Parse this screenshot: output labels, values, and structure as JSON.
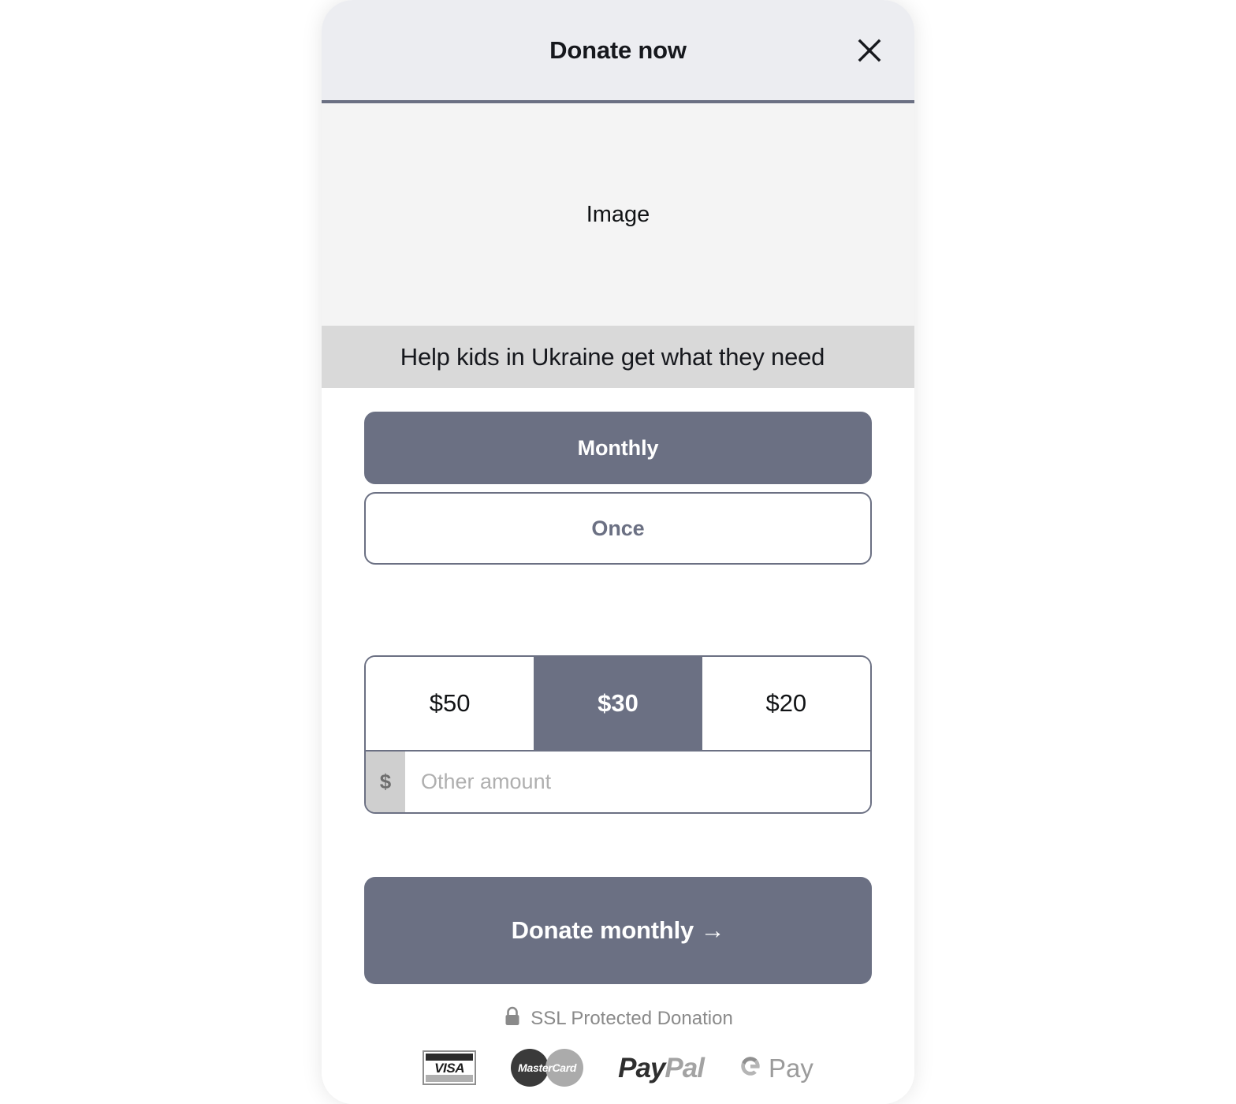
{
  "modal": {
    "header": {
      "title": "Donate now",
      "close_icon": "close-icon"
    },
    "image_placeholder": {
      "label": "Image"
    },
    "caption": "Help kids in Ukraine get what they need",
    "frequency": {
      "options": [
        {
          "label": "Monthly",
          "selected": true
        },
        {
          "label": "Once",
          "selected": false
        }
      ]
    },
    "amounts": {
      "options": [
        {
          "label": "$50",
          "selected": false
        },
        {
          "label": "$30",
          "selected": true
        },
        {
          "label": "$20",
          "selected": false
        }
      ],
      "other": {
        "currency_symbol": "$",
        "placeholder": "Other amount",
        "value": ""
      }
    },
    "cta": {
      "label": "Donate monthly →"
    },
    "security": {
      "icon": "lock-icon",
      "text": "SSL Protected Donation"
    },
    "payment_methods": [
      {
        "name": "visa",
        "label": "VISA"
      },
      {
        "name": "mastercard",
        "label": "MasterCard"
      },
      {
        "name": "paypal",
        "label_dark": "Pay",
        "label_light": "Pal"
      },
      {
        "name": "gpay",
        "label": "Pay"
      }
    ]
  },
  "colors": {
    "accent": "#6B7083",
    "header_bg": "#ECEDF1",
    "image_bg": "#F4F4F4",
    "caption_bg": "#D9D9D9",
    "muted_text": "#8A8A8A",
    "prefix_bg": "#CFCFCF"
  }
}
